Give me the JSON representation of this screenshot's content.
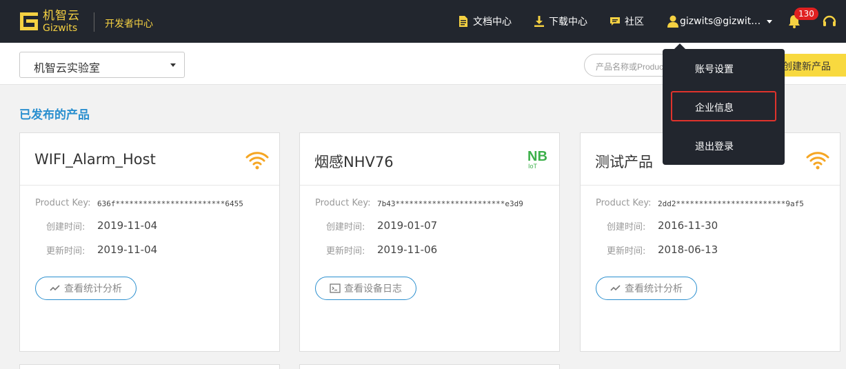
{
  "header": {
    "logo_cn": "机智云",
    "logo_en": "Gizwits",
    "dev_center": "开发者中心",
    "nav": {
      "docs": "文档中心",
      "download": "下载中心",
      "community": "社区",
      "user": "gizwits@gizwits.com"
    },
    "notification_count": "130"
  },
  "toolbar": {
    "workspace": "机智云实验室",
    "search_placeholder": "产品名称或Product Key",
    "create_label": "创建新产品"
  },
  "user_menu": {
    "items": [
      "账号设置",
      "企业信息",
      "退出登录"
    ]
  },
  "section_title": "已发布的产品",
  "products": [
    {
      "name": "WIFI_Alarm_Host",
      "icon": "wifi-icon",
      "key_label": "Product Key:",
      "key": "636f************************6455",
      "created_label": "创建时间:",
      "created": "2019-11-04",
      "updated_label": "更新时间:",
      "updated": "2019-11-04",
      "action": "查看统计分析"
    },
    {
      "name": "烟感NHV76",
      "icon": "nb-iot-icon",
      "key_label": "Product Key:",
      "key": "7b43************************e3d9",
      "created_label": "创建时间:",
      "created": "2019-01-07",
      "updated_label": "更新时间:",
      "updated": "2019-11-06",
      "action": "查看设备日志"
    },
    {
      "name": "测试产品",
      "icon": "wifi-icon",
      "key_label": "Product Key:",
      "key": "2dd2************************9af5",
      "created_label": "创建时间:",
      "created": "2016-11-30",
      "updated_label": "更新时间:",
      "updated": "2018-06-13",
      "action": "查看统计分析"
    }
  ],
  "nb_icon_text": {
    "top": "NB",
    "bottom": "IoT"
  },
  "colors": {
    "header_bg": "#22262e",
    "brand_yellow": "#f5d142",
    "accent_blue": "#2a8fcf",
    "wifi_orange": "#f5a623",
    "nb_green": "#3cb04a",
    "highlight_red": "#e0332c"
  }
}
